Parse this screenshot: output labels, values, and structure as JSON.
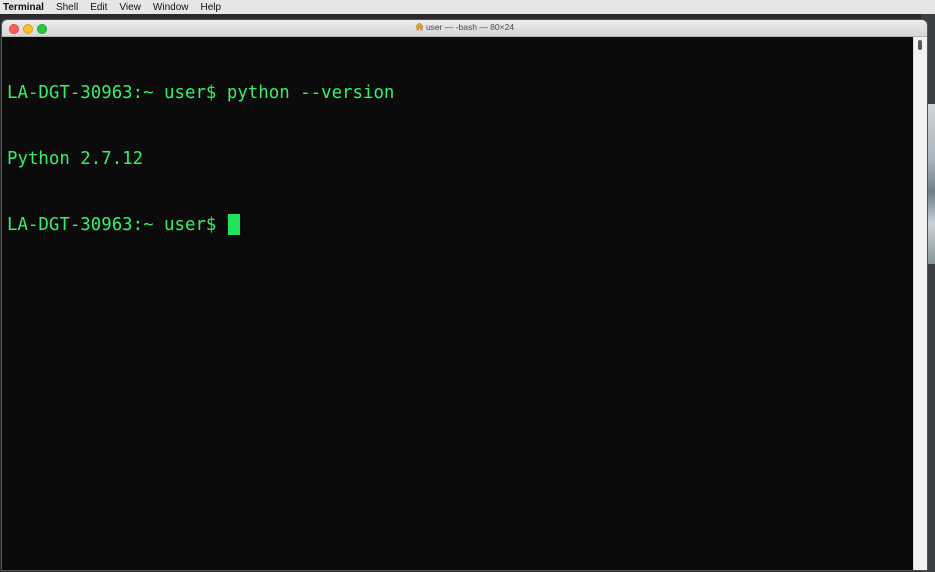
{
  "menubar": {
    "app_name": "Terminal",
    "items": [
      "Shell",
      "Edit",
      "View",
      "Window",
      "Help"
    ]
  },
  "window": {
    "title": "user — -bash — 80×24",
    "title_icon": "home-icon"
  },
  "terminal": {
    "lines": [
      "LA-DGT-30963:~ user$ python --version",
      "Python 2.7.12",
      "LA-DGT-30963:~ user$ "
    ],
    "text_color": "#35f06a",
    "background_color": "#0b0b0b",
    "cursor_color": "#22e35c"
  },
  "colors": {
    "close": "#fc5f57",
    "minimize": "#fdbc2e",
    "zoom": "#28c840"
  }
}
